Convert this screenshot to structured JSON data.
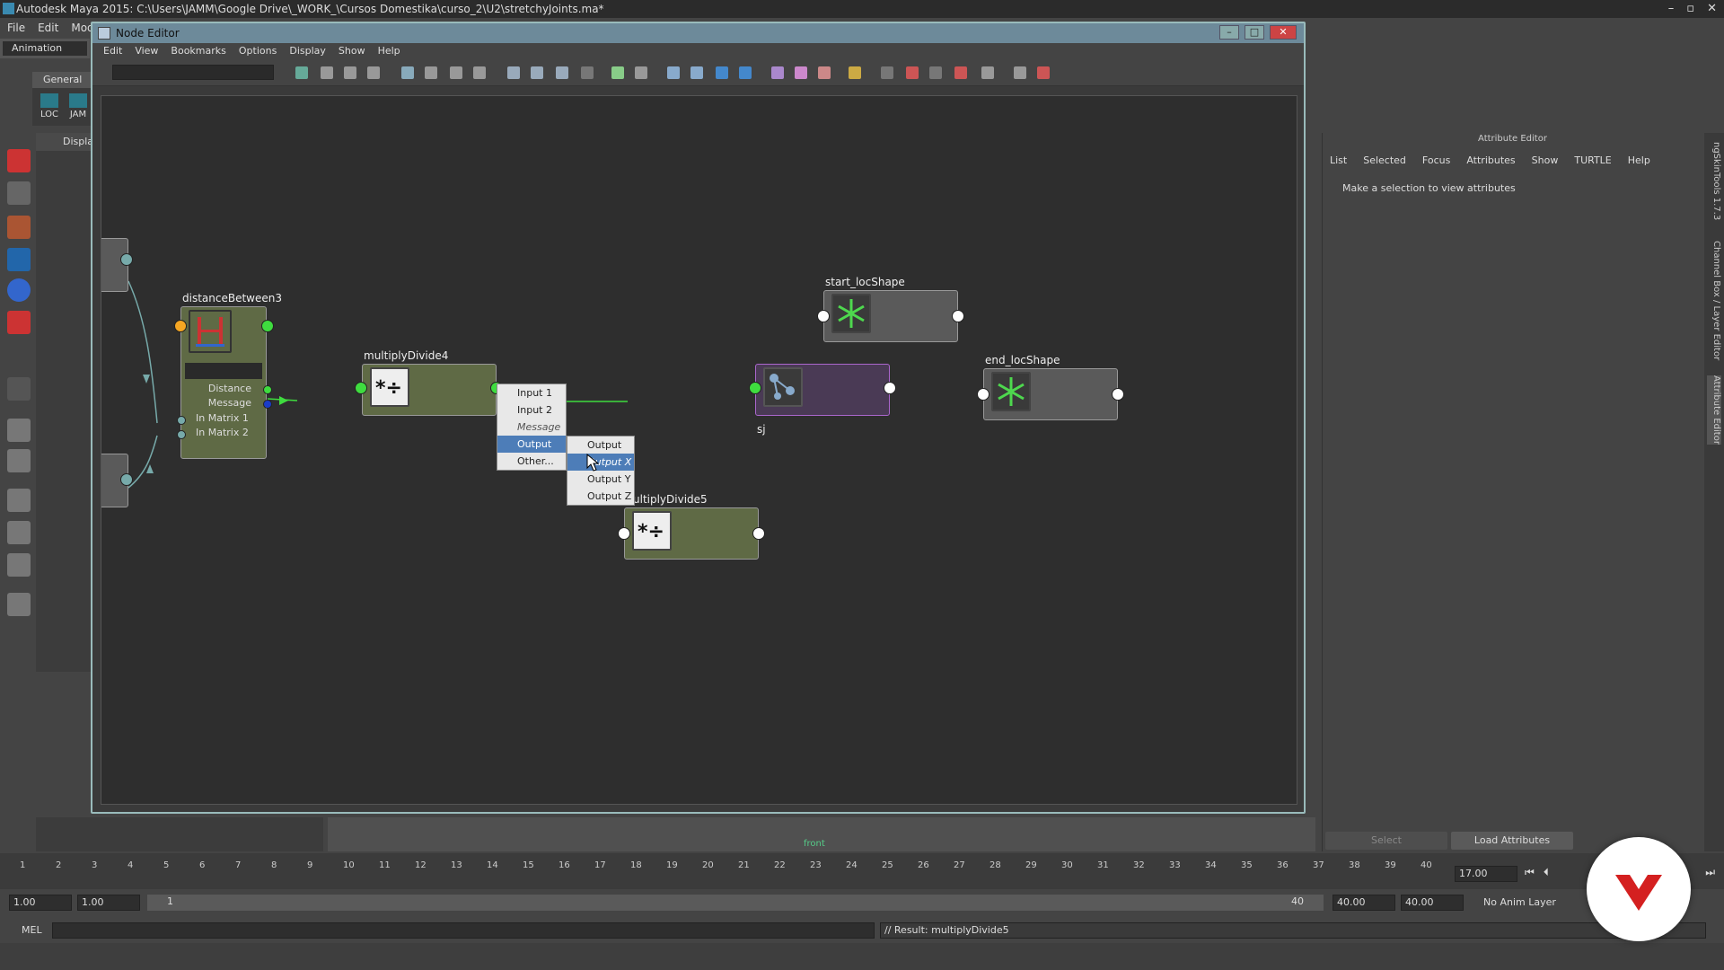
{
  "app": {
    "title": "Autodesk Maya 2015: C:\\Users\\JAMM\\Google Drive\\_WORK_\\Cursos Domestika\\curso_2\\U2\\stretchyJoints.ma*",
    "menu": [
      "File",
      "Edit",
      "Modi"
    ],
    "mode": "Animation",
    "shelf_tab": "General",
    "shelf_items": [
      "LOC",
      "JAM"
    ],
    "outliner_header": "Display"
  },
  "node_editor": {
    "title": "Node Editor",
    "menu": [
      "Edit",
      "View",
      "Bookmarks",
      "Options",
      "Display",
      "Show",
      "Help"
    ],
    "nodes": {
      "distance": {
        "name": "distanceBetween3",
        "attrs": [
          "Distance",
          "Message",
          "In Matrix 1",
          "In Matrix 2"
        ]
      },
      "md4": {
        "name": "multiplyDivide4"
      },
      "md5": {
        "name": "ultiplyDivide5"
      },
      "sj": {
        "name": "sj"
      },
      "start": {
        "name": "start_locShape"
      },
      "end": {
        "name": "end_locShape"
      }
    },
    "context_menu": {
      "items": [
        "Input 1",
        "Input 2",
        "Message",
        "Output",
        "Other..."
      ],
      "submenu": [
        "Output",
        "Output X",
        "Output Y",
        "Output Z"
      ],
      "selected": "Output",
      "sub_selected": "Output X"
    }
  },
  "attribute_editor": {
    "title": "Attribute Editor",
    "menu": [
      "List",
      "Selected",
      "Focus",
      "Attributes",
      "Show",
      "TURTLE",
      "Help"
    ],
    "message": "Make a selection to view attributes",
    "buttons": {
      "select": "Select",
      "load": "Load Attributes"
    }
  },
  "side_tabs": [
    "ngSkinTools 1.7.3",
    "Channel Box / Layer Editor",
    "Attribute Editor"
  ],
  "viewport_label": "front",
  "timeline": {
    "ticks": [
      "1",
      "2",
      "3",
      "4",
      "5",
      "6",
      "7",
      "8",
      "9",
      "10",
      "11",
      "12",
      "13",
      "14",
      "15",
      "16",
      "17",
      "18",
      "19",
      "20",
      "21",
      "22",
      "23",
      "24",
      "25",
      "26",
      "27",
      "28",
      "29",
      "30",
      "31",
      "32",
      "33",
      "34",
      "35",
      "36",
      "37",
      "38",
      "39",
      "40"
    ],
    "current": "17",
    "current_field": "17.00"
  },
  "range": {
    "start": "1.00",
    "start2": "1.00",
    "slider_start": "1",
    "slider_end": "40",
    "end": "40.00",
    "end2": "40.00",
    "anim_layer": "No Anim Layer"
  },
  "command": {
    "lang": "MEL",
    "result": "// Result: multiplyDivide5"
  },
  "colors": {
    "port_green": "#3fdc3f",
    "port_orange": "#f5a623",
    "port_blue": "#1a3cc8",
    "select_blue": "#4d7db8",
    "logo_red": "#d42020"
  }
}
